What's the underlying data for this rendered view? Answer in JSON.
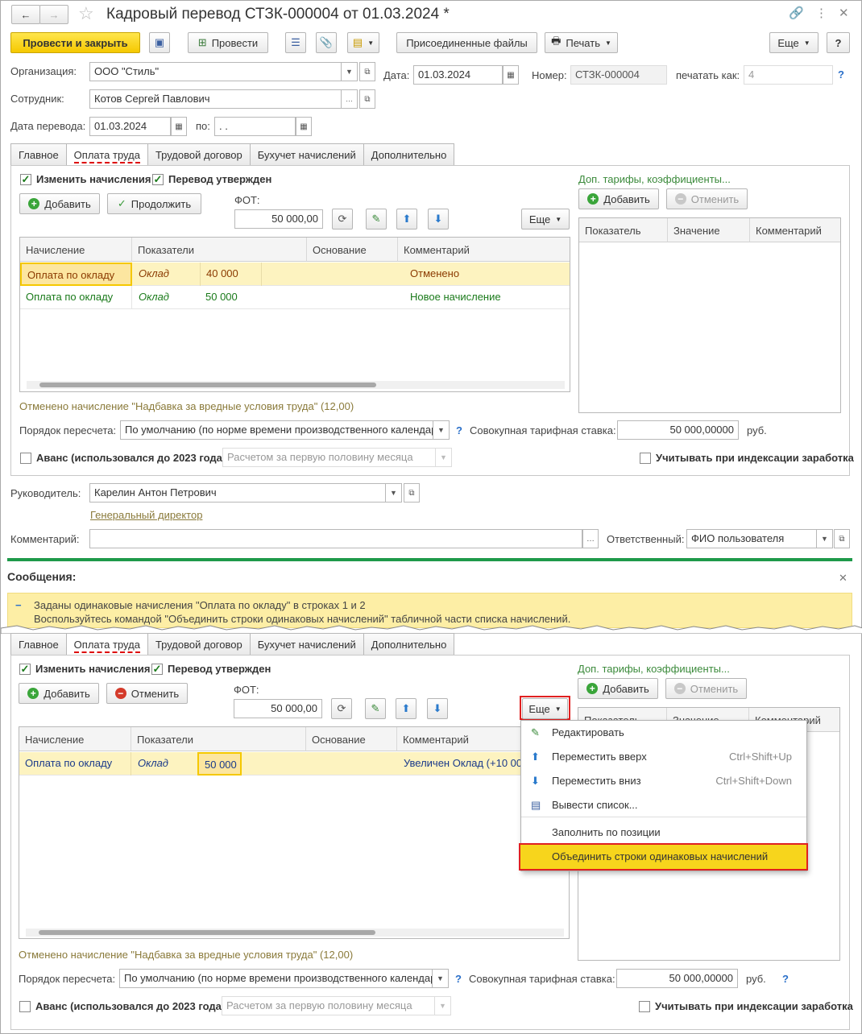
{
  "window": {
    "title": "Кадровый перевод СТЗК-000004 от 01.03.2024 *"
  },
  "toolbar": {
    "post_close": "Провести и закрыть",
    "post": "Провести",
    "attached": "Присоединенные файлы",
    "print": "Печать",
    "more": "Еще",
    "help": "?"
  },
  "header": {
    "org_label": "Организация:",
    "org_value": "ООО \"Стиль\"",
    "date_label": "Дата:",
    "date_value": "01.03.2024",
    "num_label": "Номер:",
    "num_value": "СТЗК-000004",
    "print_as_label": "печатать как:",
    "print_as_value": "4",
    "emp_label": "Сотрудник:",
    "emp_value": "Котов Сергей Павлович",
    "transfer_label": "Дата перевода:",
    "transfer_value": "01.03.2024",
    "to_label": "по:",
    "to_value": " .  ."
  },
  "tabs": [
    "Главное",
    "Оплата труда",
    "Трудовой договор",
    "Бухучет начислений",
    "Дополнительно"
  ],
  "top": {
    "cb_change": "Изменить начисления",
    "cb_approved": "Перевод утвержден",
    "add": "Добавить",
    "continue": "Продолжить",
    "fot_label": "ФОТ:",
    "fot_value": "50 000,00",
    "more": "Еще",
    "cols": [
      "Начисление",
      "Показатели",
      "Основание",
      "Комментарий"
    ],
    "rows": [
      {
        "accrual": "Оплата по окладу",
        "indicator": "Оклад",
        "value": "40 000",
        "comment": "Отменено"
      },
      {
        "accrual": "Оплата по окладу",
        "indicator": "Оклад",
        "value": "50 000",
        "comment": "Новое начисление"
      }
    ],
    "canceled_note": "Отменено начисление \"Надбавка за вредные условия труда\" (12,00)",
    "recalc_label": "Порядок пересчета:",
    "recalc_value": "По умолчанию (по норме времени производственного календаря)",
    "rate_label": "Совокупная тарифная ставка:",
    "rate_value": "50 000,00000",
    "rate_unit": "руб.",
    "advance_label": "Аванс (использовался до 2023 года)",
    "advance_value": "Расчетом за первую половину месяца",
    "index_label": "Учитывать при индексации заработка",
    "right_link": "Доп. тарифы, коэффициенты...",
    "right_add": "Добавить",
    "right_cancel": "Отменить",
    "right_cols": [
      "Показатель",
      "Значение",
      "Комментарий"
    ]
  },
  "footer": {
    "head_label": "Руководитель:",
    "head_value": "Карелин Антон Петрович",
    "head_position": "Генеральный директор",
    "comment_label": "Комментарий:",
    "resp_label": "Ответственный:",
    "resp_value": "ФИО пользователя"
  },
  "messages": {
    "title": "Сообщения:",
    "line1": "Заданы одинаковые начисления \"Оплата по окладу\" в строках 1 и 2",
    "line2": "Воспользуйтесь командой \"Объединить строки одинаковых начислений\" табличной части списка начислений."
  },
  "bottom": {
    "cb_change": "Изменить начисления",
    "cb_approved": "Перевод утвержден",
    "add": "Добавить",
    "cancel": "Отменить",
    "fot_label": "ФОТ:",
    "fot_value": "50 000,00",
    "more": "Еще",
    "cols": [
      "Начисление",
      "Показатели",
      "Основание",
      "Комментарий"
    ],
    "rows": [
      {
        "accrual": "Оплата по окладу",
        "indicator": "Оклад",
        "value": "50 000",
        "comment": "Увеличен Оклад (+10 000"
      }
    ],
    "canceled_note": "Отменено начисление \"Надбавка за вредные условия труда\" (12,00)",
    "recalc_label": "Порядок пересчета:",
    "recalc_value": "По умолчанию (по норме времени производственного календаря)",
    "rate_label": "Совокупная тарифная ставка:",
    "rate_value": "50 000,00000",
    "rate_unit": "руб.",
    "advance_label": "Аванс (использовался до 2023 года)",
    "advance_value": "Расчетом за первую половину месяца",
    "index_label": "Учитывать при индексации заработка",
    "right_link": "Доп. тарифы, коэффициенты...",
    "right_add": "Добавить",
    "right_cancel": "Отменить",
    "right_cols": [
      "Показатель",
      "Значение",
      "Комментарий"
    ]
  },
  "menu": {
    "items": [
      {
        "label": "Редактировать",
        "shortcut": ""
      },
      {
        "label": "Переместить вверх",
        "shortcut": "Ctrl+Shift+Up"
      },
      {
        "label": "Переместить вниз",
        "shortcut": "Ctrl+Shift+Down"
      },
      {
        "label": "Вывести список...",
        "shortcut": ""
      },
      {
        "label": "Заполнить по позиции",
        "shortcut": ""
      },
      {
        "label": "Объединить строки одинаковых начислений",
        "shortcut": ""
      }
    ]
  },
  "colors": {
    "accent_yellow": "#f7d51c",
    "highlight_red": "#e02020",
    "canceled_text": "#8b3a00",
    "new_text": "#1a7a1a",
    "link_green": "#3b8a3b",
    "msg_bg": "#fdeea5"
  }
}
